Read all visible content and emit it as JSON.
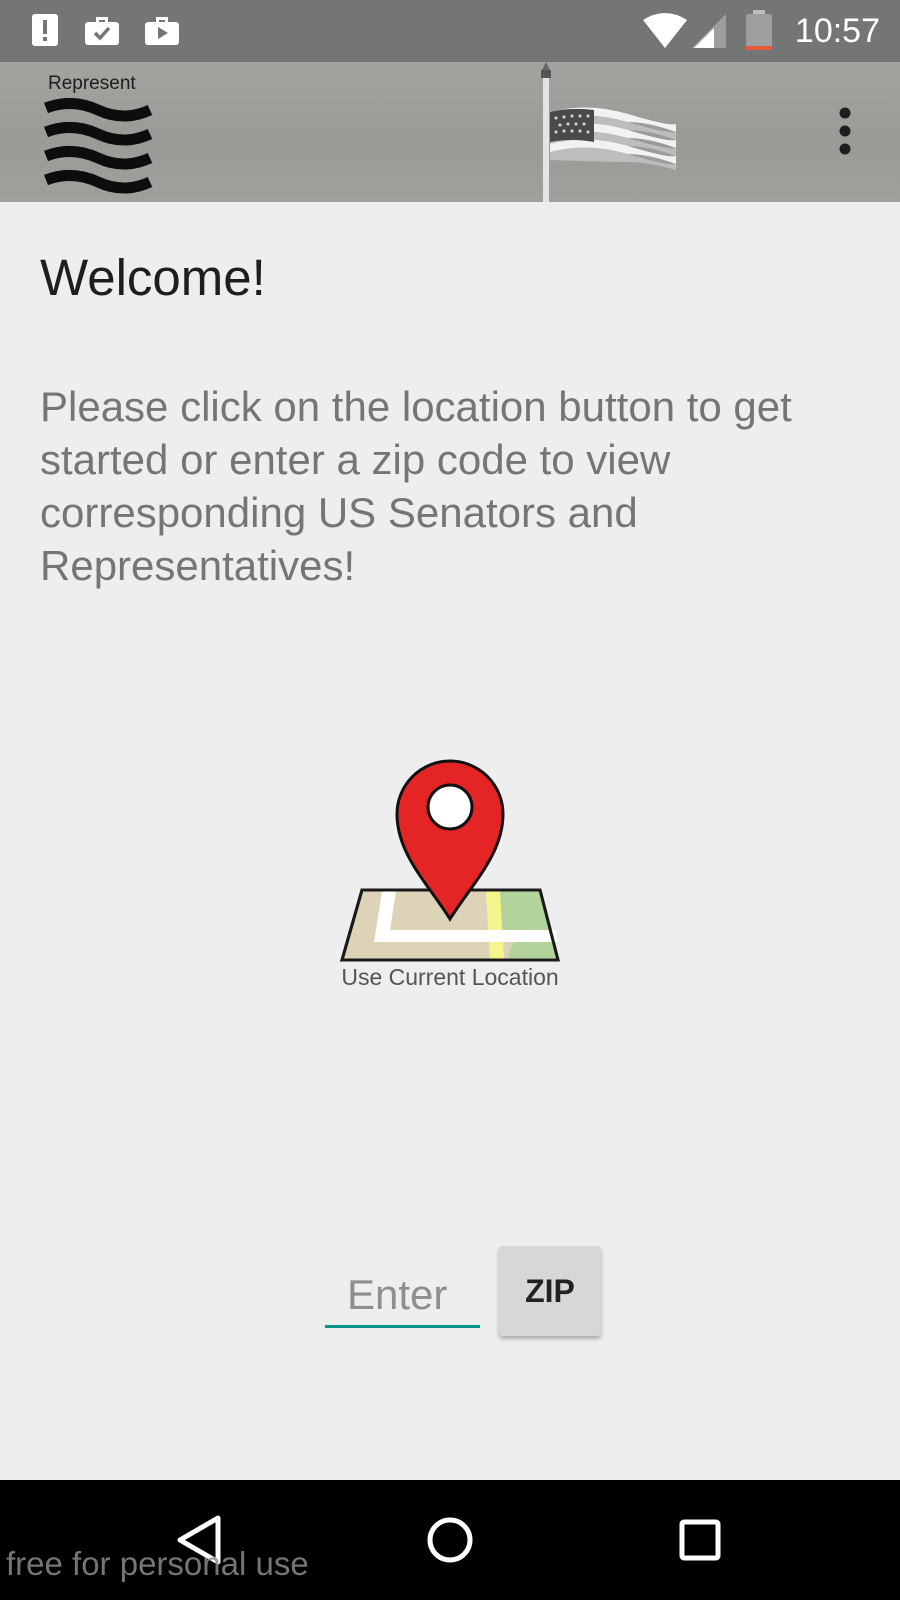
{
  "status_bar": {
    "time": "10:57",
    "left_icons": [
      "alert-icon",
      "briefcase-check-icon",
      "briefcase-play-icon"
    ],
    "right_icons": [
      "wifi-icon",
      "cell-signal-icon",
      "battery-icon"
    ]
  },
  "app_bar": {
    "logo_text": "Represent",
    "background_color": "#9e9c98",
    "menu_icon": "more-vert-icon"
  },
  "content": {
    "title": "Welcome!",
    "instructions": "Please click on the location button to get started or enter a zip code to view corresponding US Senators and Representatives!",
    "location_button_label": "Use Current Location",
    "zip_input_placeholder": "Enter",
    "zip_input_value": "",
    "zip_button_label": "ZIP",
    "accent_color": "#00968a"
  },
  "nav_bar": {
    "icons": [
      "back-icon",
      "home-icon",
      "recents-icon"
    ]
  },
  "watermark": "free for personal use"
}
